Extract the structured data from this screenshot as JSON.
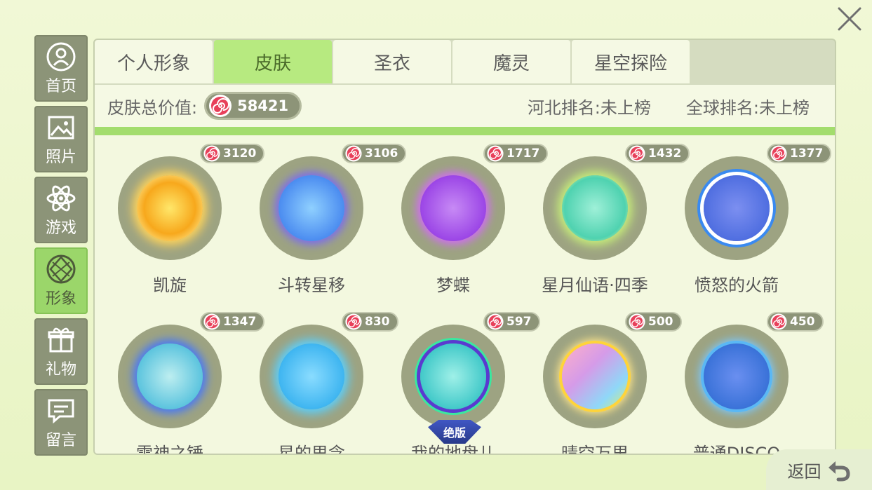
{
  "sidebar": {
    "items": [
      {
        "label": "首页",
        "icon": "home-icon"
      },
      {
        "label": "照片",
        "icon": "photo-icon"
      },
      {
        "label": "游戏",
        "icon": "atom-icon"
      },
      {
        "label": "形象",
        "icon": "avatar-icon"
      },
      {
        "label": "礼物",
        "icon": "gift-icon"
      },
      {
        "label": "留言",
        "icon": "message-icon"
      }
    ],
    "active": "形象"
  },
  "tabs": [
    {
      "label": "个人形象"
    },
    {
      "label": "皮肤"
    },
    {
      "label": "圣衣"
    },
    {
      "label": "魔灵"
    },
    {
      "label": "星空探险"
    }
  ],
  "active_tab": "皮肤",
  "summary": {
    "total_label": "皮肤总价值:",
    "total_value": "58421",
    "province_rank": "河北排名:未上榜",
    "global_rank": "全球排名:未上榜"
  },
  "skins": [
    {
      "name": "凯旋",
      "price": "3120",
      "color": "#f7a81c"
    },
    {
      "name": "斗转星移",
      "price": "3106",
      "color": "#4b8cf0"
    },
    {
      "name": "梦蝶",
      "price": "1717",
      "color": "#9b45e6"
    },
    {
      "name": "星月仙语·四季",
      "price": "1432",
      "color": "#4fd2b0"
    },
    {
      "name": "愤怒的火箭",
      "price": "1377",
      "color": "#4f6ee0"
    },
    {
      "name": "雷神之锤",
      "price": "1347",
      "color": "#5cc4de"
    },
    {
      "name": "星的思念",
      "price": "830",
      "color": "#3cb4f0"
    },
    {
      "name": "我的地盘儿",
      "price": "597",
      "color": "#3fc8c8",
      "badge": "绝版"
    },
    {
      "name": "晴空万里",
      "price": "500",
      "color": "#d59be8"
    },
    {
      "name": "普通DISCO",
      "price": "450",
      "color": "#3a72d8"
    }
  ],
  "back_label": "返回"
}
